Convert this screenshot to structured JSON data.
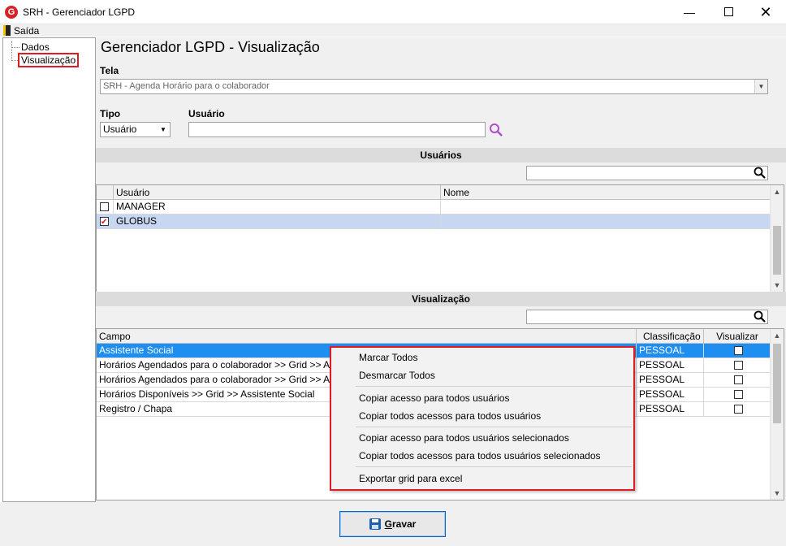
{
  "window": {
    "icon_letter": "G",
    "title": "SRH - Gerenciador LGPD",
    "minimize": "—",
    "close": "✕"
  },
  "menu": {
    "exit_label": "Saída"
  },
  "tree": {
    "items": [
      {
        "label": "Dados"
      },
      {
        "label": "Visualização",
        "selected": true
      }
    ]
  },
  "main": {
    "title": "Gerenciador LGPD - Visualização",
    "tela_label": "Tela",
    "tela_value": "SRH - Agenda Horário para o colaborador",
    "tipo_label": "Tipo",
    "tipo_value": "Usuário",
    "usuario_label": "Usuário",
    "usuario_value": ""
  },
  "users_section": {
    "title": "Usuários",
    "filter_value": "",
    "columns": [
      "Usuário",
      "Nome"
    ],
    "rows": [
      {
        "checked": false,
        "usuario": "MANAGER",
        "nome": ""
      },
      {
        "checked": true,
        "usuario": "GLOBUS",
        "nome": ""
      }
    ]
  },
  "visualizacao_section": {
    "title": "Visualização",
    "filter_value": "",
    "columns": [
      "Campo",
      "Classificação",
      "Visualizar"
    ],
    "rows": [
      {
        "campo": "Assistente Social",
        "classificacao": "PESSOAL",
        "visualizar": false
      },
      {
        "campo": "Horários Agendados para o colaborador >> Grid >> Assistente Social",
        "classificacao": "PESSOAL",
        "visualizar": false
      },
      {
        "campo": "Horários Agendados para o colaborador >> Grid >> Assunto",
        "classificacao": "PESSOAL",
        "visualizar": false
      },
      {
        "campo": "Horários Disponíveis >> Grid >> Assistente Social",
        "classificacao": "PESSOAL",
        "visualizar": false
      },
      {
        "campo": "Registro / Chapa",
        "classificacao": "PESSOAL",
        "visualizar": false
      }
    ]
  },
  "context_menu": {
    "items": [
      "Marcar Todos",
      "Desmarcar Todos",
      "Copiar acesso para todos usuários",
      "Copiar todos acessos para todos usuários",
      "Copiar acesso para todos usuários selecionados",
      "Copiar todos acessos para todos usuários selecionados",
      "Exportar grid para excel"
    ]
  },
  "footer": {
    "save_label_first": "G",
    "save_label_rest": "ravar"
  },
  "colors": {
    "highlight_red": "#e01b22",
    "row_focus_blue": "#1e8ef0",
    "row_selected": "#c7d7f2",
    "search_icon_purple": "#b04bd0"
  }
}
